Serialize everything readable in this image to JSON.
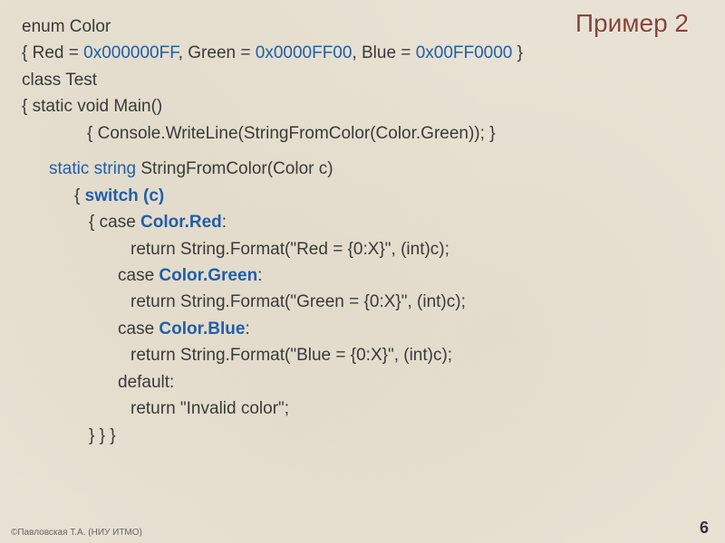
{
  "title": "Пример 2",
  "code": {
    "l01": "enum Color",
    "l02a": "{  Red = ",
    "l02b": "0x000000FF",
    "l02c": ", Green = ",
    "l02d": "0x0000FF00",
    "l02e": ", Blue = ",
    "l02f": "0x00FF0000",
    "l02g": " }",
    "l03": "class Test",
    "l04": " {  static void Main()",
    "l05": "{  Console.WriteLine(StringFromColor(Color.Green)); }",
    "l06a": "static string",
    "l06b": " StringFromColor(Color c)",
    "l07a": "{  ",
    "l07b": "switch (c)",
    "l08a": "{  case ",
    "l08b": "Color.Red",
    "l08c": ":",
    "l09": "return String.Format(\"Red = {0:X}\", (int)c);",
    "l10a": "case ",
    "l10b": "Color.Green",
    "l10c": ":",
    "l11": "return String.Format(\"Green = {0:X}\", (int)c);",
    "l12a": "case ",
    "l12b": "Color.Blue",
    "l12c": ":",
    "l13": "return String.Format(\"Blue = {0:X}\", (int)c);",
    "l14": "default:",
    "l15": "return \"Invalid color\";",
    "l16": "}  }  }"
  },
  "footer": "©Павловская Т.А. (НИУ ИТМО)",
  "page_number": "6"
}
